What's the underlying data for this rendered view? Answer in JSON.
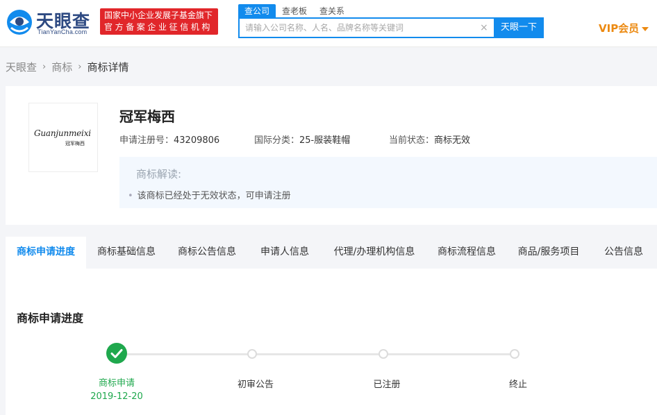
{
  "header": {
    "logo_text": "天眼查",
    "logo_sub": "TianYanCha.com",
    "gov_badge_line1": "国家中小企业发展子基金旗下",
    "gov_badge_line2": "官方备案企业征信机构",
    "search_tabs": [
      {
        "label": "查公司",
        "active": true
      },
      {
        "label": "查老板",
        "active": false
      },
      {
        "label": "查关系",
        "active": false
      }
    ],
    "search_placeholder": "请输入公司名称、人名、品牌名称等关键词",
    "search_button": "天眼一下",
    "vip_label": "VIP会员",
    "brand_color": "#128bed",
    "badge_color": "#e1262a",
    "vip_color": "#ec8a12"
  },
  "breadcrumb": [
    "天眼查",
    "商标",
    "商标详情"
  ],
  "trademark": {
    "logo_script": "Guanjunmeixi",
    "logo_cn": "冠军梅西",
    "name": "冠军梅西",
    "reg_no_label": "申请注册号：",
    "reg_no": "43209806",
    "class_label": "国际分类：",
    "class_value": "25-服装鞋帽",
    "status_label": "当前状态：",
    "status_value": "商标无效",
    "interpretation_title": "商标解读:",
    "interpretation_text": "该商标已经处于无效状态，可申请注册"
  },
  "tabs": [
    {
      "label": "商标申请进度",
      "active": true
    },
    {
      "label": "商标基础信息",
      "active": false
    },
    {
      "label": "商标公告信息",
      "active": false
    },
    {
      "label": "申请人信息",
      "active": false
    },
    {
      "label": "代理/办理机构信息",
      "active": false
    },
    {
      "label": "商标流程信息",
      "active": false
    },
    {
      "label": "商品/服务项目",
      "active": false
    },
    {
      "label": "公告信息",
      "active": false
    }
  ],
  "progress": {
    "title": "商标申请进度",
    "steps": [
      {
        "label": "商标申请",
        "date": "2019-12-20",
        "done": true
      },
      {
        "label": "初审公告",
        "date": "",
        "done": false
      },
      {
        "label": "已注册",
        "date": "",
        "done": false
      },
      {
        "label": "终止",
        "date": "",
        "done": false
      }
    ],
    "done_color": "#1fa84d"
  }
}
